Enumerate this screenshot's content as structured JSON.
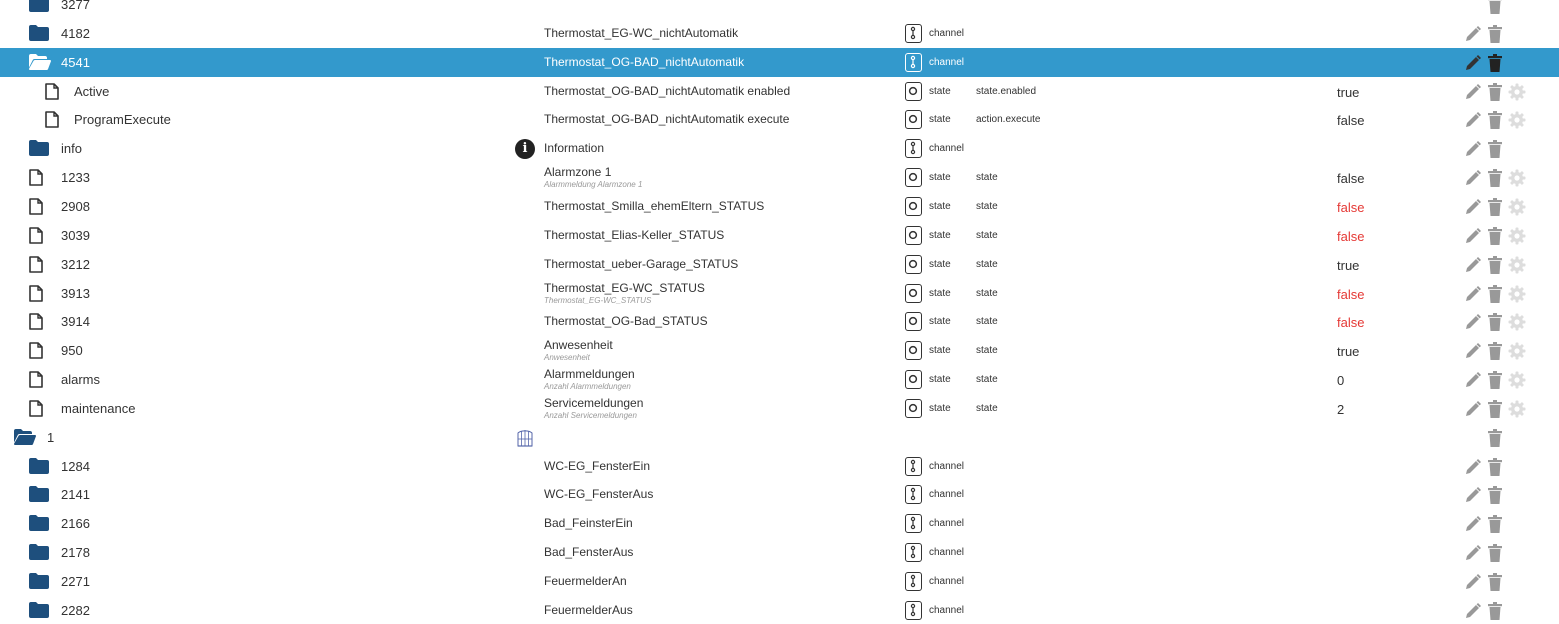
{
  "colors": {
    "selected_row_bg": "#3399cc",
    "folder_icon": "#1e4f7d",
    "value_false_alert": "#e53935",
    "action_icon": "#999999",
    "gear_icon": "#dddddd"
  },
  "icons": {
    "folder_closed": "folder-icon",
    "folder_open": "folder-open-icon",
    "file": "file-icon",
    "channel": "channel-icon",
    "state": "state-icon",
    "info": "info-icon",
    "enum": "enum-icon",
    "edit": "pencil-icon",
    "delete": "trash-icon",
    "settings": "gear-icon"
  },
  "rows": [
    {
      "id": "3277",
      "icon": "folder",
      "indent": 1,
      "name": "",
      "desc": "",
      "type": "",
      "role": "",
      "value": "",
      "value_red": false,
      "actions": [
        "delete"
      ],
      "selected": false
    },
    {
      "id": "4182",
      "icon": "folder",
      "indent": 1,
      "name": "Thermostat_EG-WC_nichtAutomatik",
      "desc": "",
      "type": "channel",
      "role": "",
      "value": "",
      "value_red": false,
      "actions": [
        "edit",
        "delete"
      ],
      "selected": false
    },
    {
      "id": "4541",
      "icon": "folder-open",
      "indent": 1,
      "name": "Thermostat_OG-BAD_nichtAutomatik",
      "desc": "",
      "type": "channel",
      "role": "",
      "value": "",
      "value_red": false,
      "actions": [
        "edit",
        "delete"
      ],
      "selected": true
    },
    {
      "id": "Active",
      "icon": "file",
      "indent": 2,
      "name": "Thermostat_OG-BAD_nichtAutomatik enabled",
      "desc": "",
      "type": "state",
      "role": "state.enabled",
      "value": "true",
      "value_red": false,
      "actions": [
        "edit",
        "delete",
        "settings"
      ],
      "selected": false
    },
    {
      "id": "ProgramExecute",
      "icon": "file",
      "indent": 2,
      "name": "Thermostat_OG-BAD_nichtAutomatik execute",
      "desc": "",
      "type": "state",
      "role": "action.execute",
      "value": "false",
      "value_red": false,
      "actions": [
        "edit",
        "delete",
        "settings"
      ],
      "selected": false
    },
    {
      "id": "info",
      "icon": "folder",
      "indent": 1,
      "name": "Information",
      "desc": "",
      "type": "channel",
      "role": "",
      "value": "",
      "value_red": false,
      "actions": [
        "edit",
        "delete"
      ],
      "selected": false,
      "badge": "info"
    },
    {
      "id": "1233",
      "icon": "file",
      "indent": 1,
      "name": "Alarmzone 1",
      "desc": "Alarmmeldung Alarmzone 1",
      "type": "state",
      "role": "state",
      "value": "false",
      "value_red": false,
      "actions": [
        "edit",
        "delete",
        "settings"
      ],
      "selected": false
    },
    {
      "id": "2908",
      "icon": "file",
      "indent": 1,
      "name": "Thermostat_Smilla_ehemEltern_STATUS",
      "desc": "",
      "type": "state",
      "role": "state",
      "value": "false",
      "value_red": true,
      "actions": [
        "edit",
        "delete",
        "settings"
      ],
      "selected": false
    },
    {
      "id": "3039",
      "icon": "file",
      "indent": 1,
      "name": "Thermostat_Elias-Keller_STATUS",
      "desc": "",
      "type": "state",
      "role": "state",
      "value": "false",
      "value_red": true,
      "actions": [
        "edit",
        "delete",
        "settings"
      ],
      "selected": false
    },
    {
      "id": "3212",
      "icon": "file",
      "indent": 1,
      "name": "Thermostat_ueber-Garage_STATUS",
      "desc": "",
      "type": "state",
      "role": "state",
      "value": "true",
      "value_red": false,
      "actions": [
        "edit",
        "delete",
        "settings"
      ],
      "selected": false
    },
    {
      "id": "3913",
      "icon": "file",
      "indent": 1,
      "name": "Thermostat_EG-WC_STATUS",
      "desc": "Thermostat_EG-WC_STATUS",
      "type": "state",
      "role": "state",
      "value": "false",
      "value_red": true,
      "actions": [
        "edit",
        "delete",
        "settings"
      ],
      "selected": false
    },
    {
      "id": "3914",
      "icon": "file",
      "indent": 1,
      "name": "Thermostat_OG-Bad_STATUS",
      "desc": "",
      "type": "state",
      "role": "state",
      "value": "false",
      "value_red": true,
      "actions": [
        "edit",
        "delete",
        "settings"
      ],
      "selected": false
    },
    {
      "id": "950",
      "icon": "file",
      "indent": 1,
      "name": "Anwesenheit",
      "desc": "Anwesenheit",
      "type": "state",
      "role": "state",
      "value": "true",
      "value_red": false,
      "actions": [
        "edit",
        "delete",
        "settings"
      ],
      "selected": false
    },
    {
      "id": "alarms",
      "icon": "file",
      "indent": 1,
      "name": "Alarmmeldungen",
      "desc": "Anzahl Alarmmeldungen",
      "type": "state",
      "role": "state",
      "value": "0",
      "value_red": false,
      "actions": [
        "edit",
        "delete",
        "settings"
      ],
      "selected": false
    },
    {
      "id": "maintenance",
      "icon": "file",
      "indent": 1,
      "name": "Servicemeldungen",
      "desc": "Anzahl Servicemeldungen",
      "type": "state",
      "role": "state",
      "value": "2",
      "value_red": false,
      "actions": [
        "edit",
        "delete",
        "settings"
      ],
      "selected": false
    },
    {
      "id": "1",
      "icon": "folder-open",
      "indent": 0,
      "name": "",
      "desc": "",
      "type": "",
      "role": "",
      "value": "",
      "value_red": false,
      "actions": [
        "delete"
      ],
      "selected": false,
      "badge": "enum"
    },
    {
      "id": "1284",
      "icon": "folder",
      "indent": 1,
      "name": "WC-EG_FensterEin",
      "desc": "",
      "type": "channel",
      "role": "",
      "value": "",
      "value_red": false,
      "actions": [
        "edit",
        "delete"
      ],
      "selected": false
    },
    {
      "id": "2141",
      "icon": "folder",
      "indent": 1,
      "name": "WC-EG_FensterAus",
      "desc": "",
      "type": "channel",
      "role": "",
      "value": "",
      "value_red": false,
      "actions": [
        "edit",
        "delete"
      ],
      "selected": false
    },
    {
      "id": "2166",
      "icon": "folder",
      "indent": 1,
      "name": "Bad_FeinsterEin",
      "desc": "",
      "type": "channel",
      "role": "",
      "value": "",
      "value_red": false,
      "actions": [
        "edit",
        "delete"
      ],
      "selected": false
    },
    {
      "id": "2178",
      "icon": "folder",
      "indent": 1,
      "name": "Bad_FensterAus",
      "desc": "",
      "type": "channel",
      "role": "",
      "value": "",
      "value_red": false,
      "actions": [
        "edit",
        "delete"
      ],
      "selected": false
    },
    {
      "id": "2271",
      "icon": "folder",
      "indent": 1,
      "name": "FeuermelderAn",
      "desc": "",
      "type": "channel",
      "role": "",
      "value": "",
      "value_red": false,
      "actions": [
        "edit",
        "delete"
      ],
      "selected": false
    },
    {
      "id": "2282",
      "icon": "folder",
      "indent": 1,
      "name": "FeuermelderAus",
      "desc": "",
      "type": "channel",
      "role": "",
      "value": "",
      "value_red": false,
      "actions": [
        "edit",
        "delete"
      ],
      "selected": false
    }
  ]
}
